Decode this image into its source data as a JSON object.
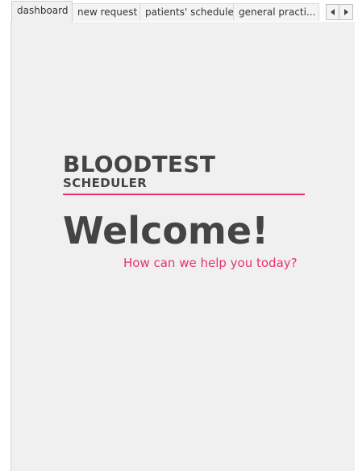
{
  "tabs": [
    {
      "label": "dashboard",
      "active": true
    },
    {
      "label": "new request",
      "active": false
    },
    {
      "label": "patients' schedule",
      "active": false
    },
    {
      "label": "general practi...",
      "active": false
    }
  ],
  "tab_nav": {
    "prev_icon": "chevron-left-icon",
    "next_icon": "chevron-right-icon"
  },
  "dashboard": {
    "logo_title": "BLOODTEST",
    "logo_subtitle": "SCHEDULER",
    "welcome": "Welcome!",
    "tagline": "How can we help you today?"
  },
  "colors": {
    "accent": "#e8336a",
    "text": "#444444",
    "panel_bg": "#f0f0f0"
  }
}
